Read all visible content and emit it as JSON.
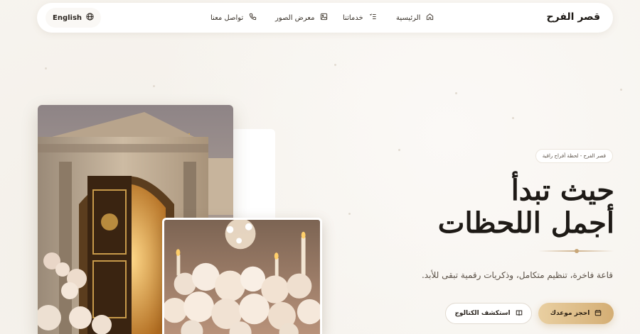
{
  "nav": {
    "brand": "قصر الفرح",
    "language": "English",
    "items": [
      {
        "label": "الرئيسية",
        "icon": "home-icon"
      },
      {
        "label": "خدماتنا",
        "icon": "list-icon"
      },
      {
        "label": "معرض الصور",
        "icon": "image-icon"
      },
      {
        "label": "تواصل معنا",
        "icon": "phone-icon"
      }
    ]
  },
  "hero": {
    "badge": "قصر الفرح - لحظة أفراح راقية",
    "headline_line1": "حيث تبدأ",
    "headline_line2": "أجمل اللحظات",
    "subtitle": "قاعة فاخرة، تنظيم متكامل، وذكريات رقمية تبقى للأبد.",
    "primary_button": "احجز موعدك",
    "secondary_button": "استكشف الكتالوج"
  },
  "colors": {
    "background": "#f7f4ef",
    "accent_gold": "#d4ae74",
    "text_dark": "#1e1a16"
  }
}
